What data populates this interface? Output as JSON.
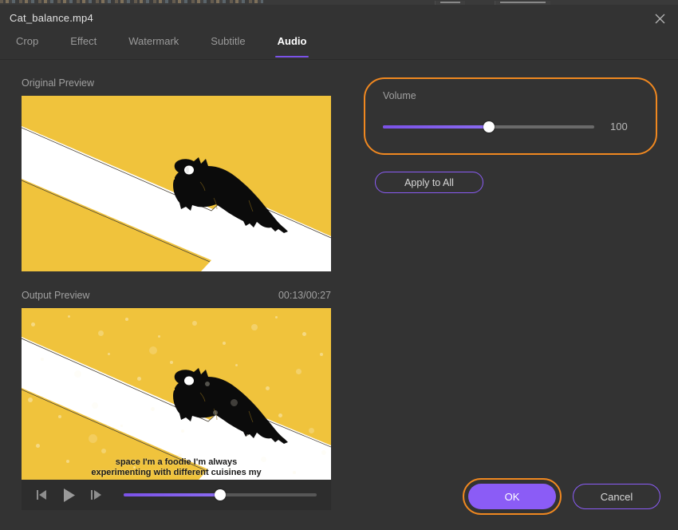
{
  "window": {
    "title": "Cat_balance.mp4",
    "close_icon": "close-icon"
  },
  "tabs": [
    {
      "label": "Crop",
      "active": false
    },
    {
      "label": "Effect",
      "active": false
    },
    {
      "label": "Watermark",
      "active": false
    },
    {
      "label": "Subtitle",
      "active": false
    },
    {
      "label": "Audio",
      "active": true
    }
  ],
  "previews": {
    "original": {
      "label": "Original Preview"
    },
    "output": {
      "label": "Output Preview",
      "timestamp": "00:13/00:27",
      "subtitle_line1": "space I'm a foodie I'm always",
      "subtitle_line2": "experimenting with different cuisines my"
    }
  },
  "player": {
    "prev_frame_icon": "step-backward-icon",
    "play_icon": "play-icon",
    "next_frame_icon": "step-forward-icon",
    "progress_percent": 50
  },
  "audio": {
    "volume_label": "Volume",
    "volume_value": "100",
    "volume_percent": 50,
    "apply_to_all_label": "Apply to All"
  },
  "footer": {
    "ok_label": "OK",
    "cancel_label": "Cancel"
  },
  "colors": {
    "dialog_bg": "#333333",
    "accent_purple": "#8b5cf6",
    "highlight_orange": "#f08820",
    "video_yellow": "#f0c33c",
    "text_muted": "#a0a0a0"
  }
}
